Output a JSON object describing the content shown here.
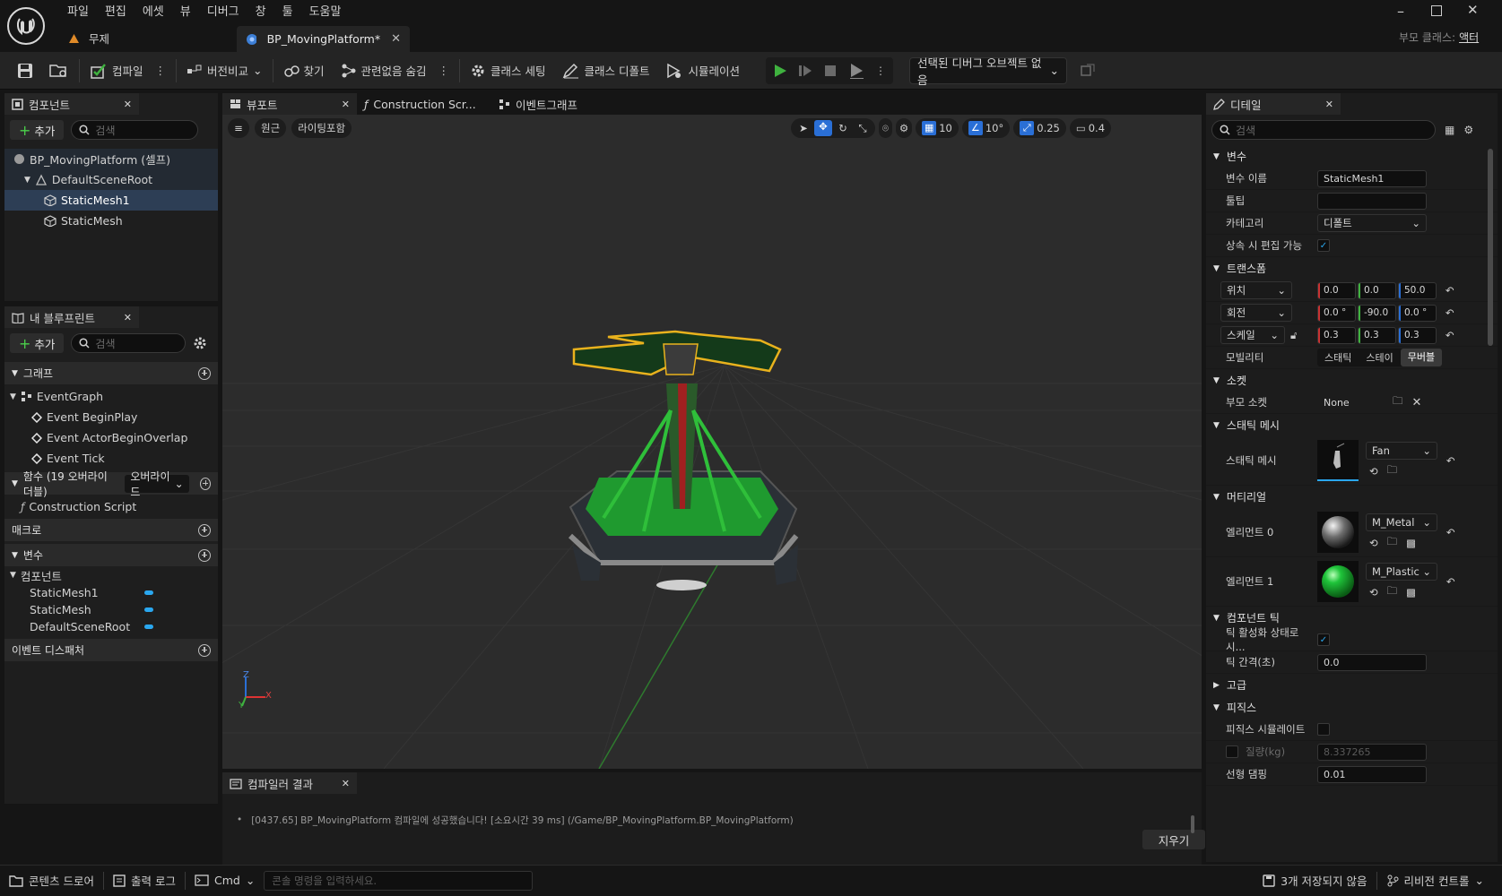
{
  "window": {
    "menu": [
      "파일",
      "편집",
      "에셋",
      "뷰",
      "디버그",
      "창",
      "툴",
      "도움말"
    ],
    "level_tab": "무제",
    "asset_tab": "BP_MovingPlatform*",
    "parent_class_label": "부모 클래스:",
    "parent_class_value": "액터"
  },
  "toolbar": {
    "compile": "컴파일",
    "diff": "버전비교",
    "find": "찾기",
    "hide_unrelated": "관련없음 숨김",
    "class_settings": "클래스 세팅",
    "class_defaults": "클래스 디폴트",
    "simulation": "시뮬레이션",
    "debug_object": "선택된 디버그 오브젝트 없음"
  },
  "components_panel": {
    "title": "컴포넌트",
    "add": "추가",
    "search_placeholder": "검색",
    "tree": [
      "BP_MovingPlatform (셀프)",
      "DefaultSceneRoot",
      "StaticMesh1",
      "StaticMesh"
    ],
    "selected": "StaticMesh1"
  },
  "my_blueprint": {
    "title": "내 블루프린트",
    "add": "추가",
    "search_placeholder": "검색",
    "graphs_label": "그래프",
    "event_graph": "EventGraph",
    "events": [
      "Event BeginPlay",
      "Event ActorBeginOverlap",
      "Event Tick"
    ],
    "functions_label": "함수 (19 오버라이더블)",
    "override_label": "오버라이드",
    "construction_script": "Construction Script",
    "macros_label": "매크로",
    "variables_label": "변수",
    "components_label": "컴포넌트",
    "variables": [
      "StaticMesh1",
      "StaticMesh",
      "DefaultSceneRoot"
    ],
    "dispatchers_label": "이벤트 디스패처",
    "variable_color": "#2aa7ef"
  },
  "viewport": {
    "tabs": [
      "뷰포트",
      "Construction Scr...",
      "이벤트그래프"
    ],
    "perspective": "원근",
    "lit": "라이팅포함",
    "grid_snap": "10",
    "rotation_snap": "10°",
    "scale_snap": "0.25",
    "camera_speed": "0.4",
    "axis_labels": [
      "Z",
      "X",
      "Y"
    ]
  },
  "compiler_results": {
    "title": "컴파일러 결과",
    "message": "[0437.65] BP_MovingPlatform 컴파일에 성공했습니다! [소요시간 39 ms] (/Game/BP_MovingPlatform.BP_MovingPlatform)",
    "clear": "지우기"
  },
  "details": {
    "title": "디테일",
    "search_placeholder": "검색",
    "variable_section": "변수",
    "variable_name_label": "변수 이름",
    "variable_name_value": "StaticMesh1",
    "tooltip_label": "툴팁",
    "category_label": "카테고리",
    "category_value": "디폴트",
    "editable_label": "상속 시 편집 가능",
    "transform_section": "트랜스폼",
    "location_label": "위치",
    "location": [
      "0.0",
      "0.0",
      "50.0"
    ],
    "rotation_label": "회전",
    "rotation": [
      "0.0 °",
      "-90.0",
      "0.0 °"
    ],
    "scale_label": "스케일",
    "scale": [
      "0.3",
      "0.3",
      "0.3"
    ],
    "mobility_label": "모빌리티",
    "mobility_options": [
      "스태틱",
      "스테이",
      "무버블"
    ],
    "mobility_selected": "무버블",
    "sockets_section": "소켓",
    "parent_socket_label": "부모 소켓",
    "parent_socket_value": "None",
    "static_mesh_section": "스태틱 메시",
    "static_mesh_label": "스태틱 메시",
    "static_mesh_value": "Fan",
    "materials_section": "머티리얼",
    "element0_label": "엘리먼트 0",
    "element0_value": "M_Metal",
    "element1_label": "엘리먼트 1",
    "element1_value": "M_Plastic",
    "tick_section": "컴포넌트 틱",
    "tick_enabled_label": "틱 활성화 상태로 시...",
    "tick_interval_label": "틱 간격(초)",
    "tick_interval_value": "0.0",
    "advanced_section": "고급",
    "physics_section": "피직스",
    "simulate_physics_label": "피직스 시뮬레이트",
    "mass_label": "질량(kg)",
    "mass_value": "8.337265",
    "linear_damping_label": "선형 댐핑",
    "linear_damping_value": "0.01"
  },
  "statusbar": {
    "content_drawer": "콘텐츠 드로어",
    "output_log": "출력 로그",
    "cmd": "Cmd",
    "console_placeholder": "콘솔 명령을 입력하세요.",
    "unsaved": "3개 저장되지 않음",
    "revision_control": "리비전 컨트롤"
  },
  "colors": {
    "accent": "#2aa7ef",
    "play_green": "#3fb23f",
    "selection_blue": "#2d3e55"
  }
}
